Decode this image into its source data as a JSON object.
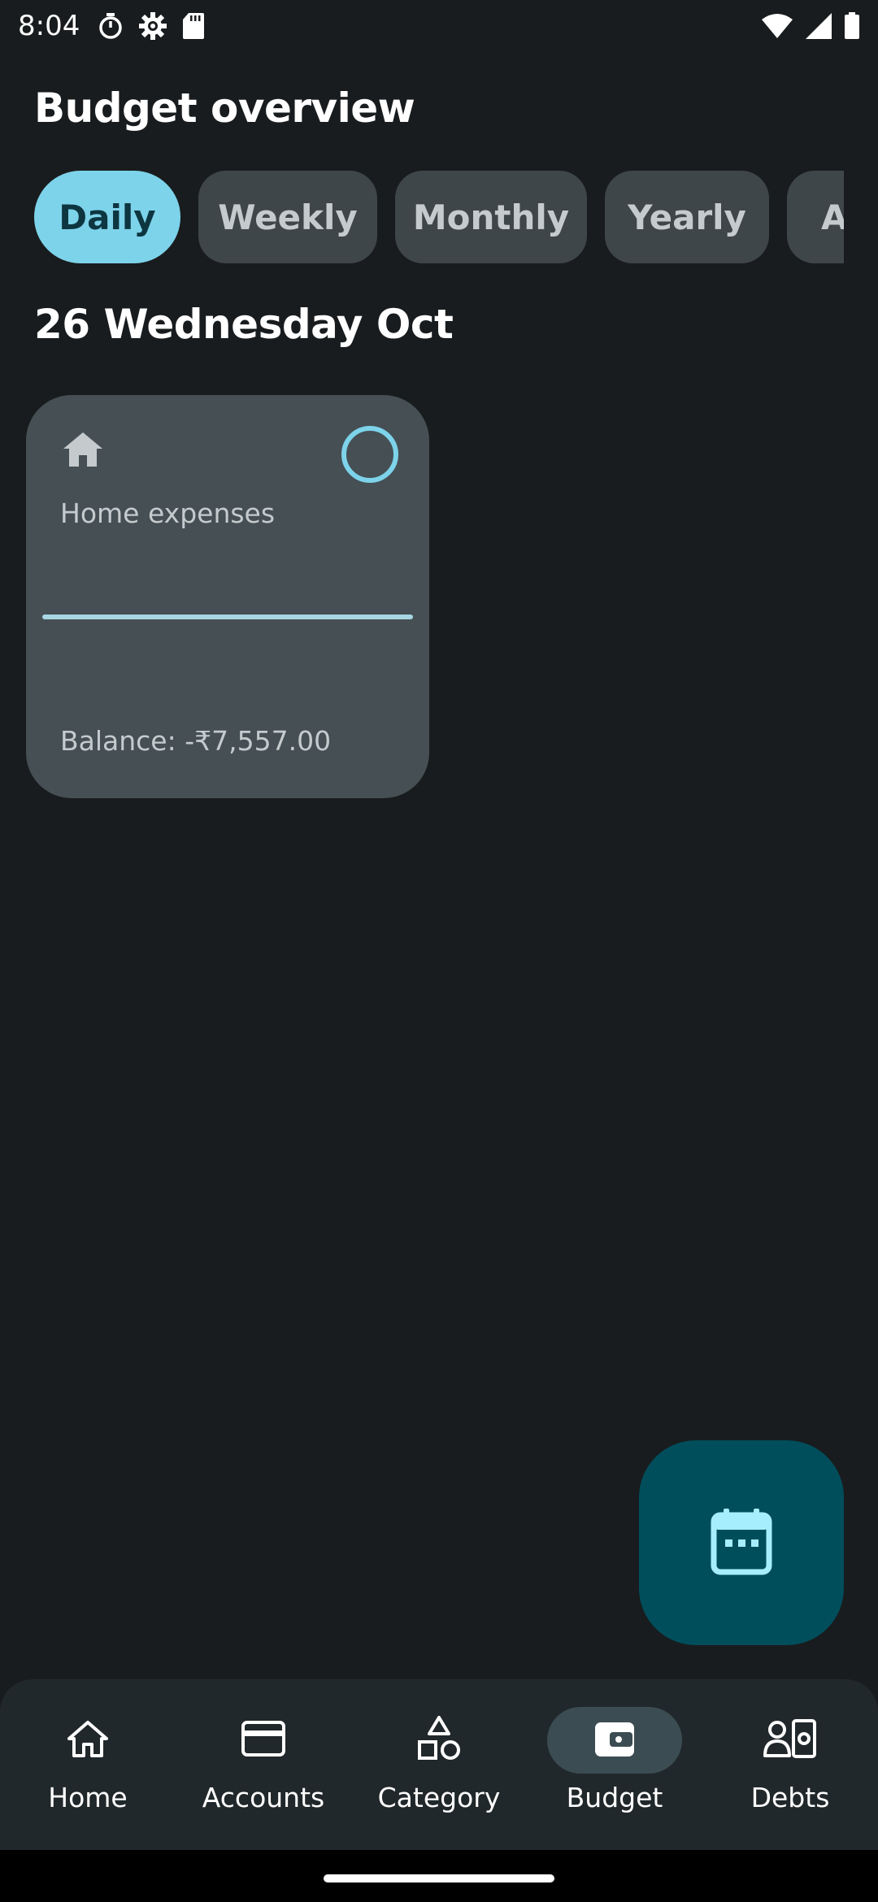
{
  "status_bar": {
    "time": "8:04"
  },
  "header": {
    "title": "Budget overview"
  },
  "period_tabs": [
    {
      "label": "Daily",
      "active": true
    },
    {
      "label": "Weekly",
      "active": false
    },
    {
      "label": "Monthly",
      "active": false
    },
    {
      "label": "Yearly",
      "active": false
    },
    {
      "label": "A",
      "active": false
    }
  ],
  "date_heading": "26 Wednesday Oct",
  "budget_card": {
    "icon": "home-icon",
    "name": "Home expenses",
    "progress_fraction": 1.0,
    "balance": "Balance: -₹7,557.00"
  },
  "fab": {
    "icon": "calendar-icon"
  },
  "bottom_nav": [
    {
      "label": "Home",
      "icon": "home-icon",
      "active": false
    },
    {
      "label": "Accounts",
      "icon": "credit-card-icon",
      "active": false
    },
    {
      "label": "Category",
      "icon": "shapes-icon",
      "active": false
    },
    {
      "label": "Budget",
      "icon": "wallet-icon",
      "active": true
    },
    {
      "label": "Debts",
      "icon": "debts-icon",
      "active": false
    }
  ],
  "colors": {
    "background": "#191c1e",
    "accent": "#7dd3ea",
    "card": "#454f54",
    "fab": "#004e5c",
    "nav": "#21282b"
  }
}
